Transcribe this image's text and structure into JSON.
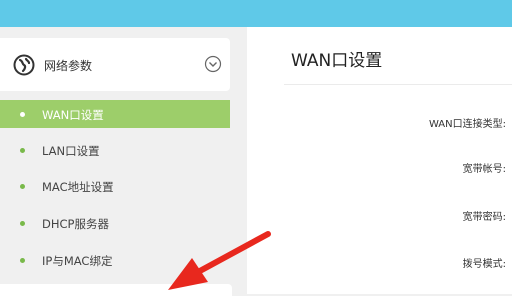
{
  "sidebar": {
    "section_title": "网络参数",
    "items": [
      {
        "label": "WAN口设置",
        "active": true
      },
      {
        "label": "LAN口设置",
        "active": false
      },
      {
        "label": "MAC地址设置",
        "active": false
      },
      {
        "label": "DHCP服务器",
        "active": false
      },
      {
        "label": "IP与MAC绑定",
        "active": false
      }
    ]
  },
  "main": {
    "title": "WAN口设置",
    "form": {
      "connection_type_label": "WAN口连接类型:",
      "account_label": "宽带帐号:",
      "password_label": "宽带密码:",
      "dial_mode_label": "拨号模式:"
    }
  },
  "colors": {
    "topbar": "#5fc9e8",
    "active_item": "#9dce6a",
    "dot": "#79b94a",
    "arrow": "#e8281e"
  },
  "icons": {
    "section": "globe-icon",
    "toggle": "chevron-down-icon",
    "annotation": "red-arrow-icon"
  }
}
